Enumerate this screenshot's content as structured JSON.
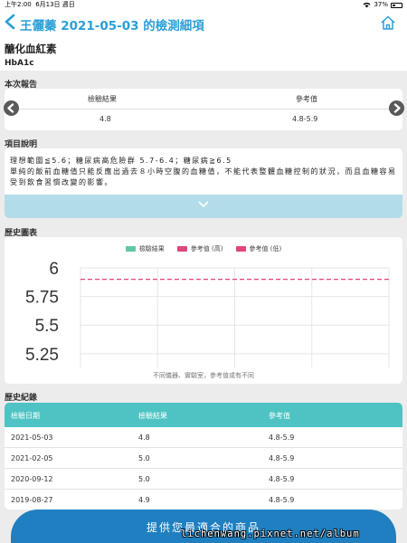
{
  "status_bar": {
    "time": "上午2:00",
    "date": "6月13日 週日",
    "battery": "37%"
  },
  "nav": {
    "title": "王儷蓁 2021-05-03 的檢測細項"
  },
  "item": {
    "name": "醣化血紅素",
    "code": "HbA1c"
  },
  "report": {
    "section_label": "本次報告",
    "col_result": "檢驗結果",
    "col_reference": "參考值",
    "result_value": "4.8",
    "reference_value": "4.8-5.9"
  },
  "description": {
    "section_label": "項目說明",
    "line1": "理想範圍≦5.6；糖尿病高危險群 5.7-6.4；糖尿病≧6.5",
    "line2": "單純的飯前血糖值只能反應出過去８小時空腹的血糖值，不能代表整體血糖控制的狀況，而且血糖容易受到飲食習慣改變的影響。"
  },
  "chart": {
    "section_label": "歷史圖表",
    "note": "不同儀器、實驗室，參考值或有不同"
  },
  "chart_data": {
    "type": "line",
    "y_ticks": [
      "6",
      "5.75",
      "5.5",
      "5.25"
    ],
    "ylim": [
      5.13,
      6.0
    ],
    "grid": true,
    "legend_position": "top-center",
    "series": [
      {
        "name": "檢驗結果",
        "color": "#5ec8a6",
        "values": []
      },
      {
        "name": "參考值 (高)",
        "color": "#e0457b",
        "values": [
          5.9
        ]
      },
      {
        "name": "參考值 (低)",
        "color": "#e0457b",
        "values": []
      }
    ],
    "x_gridlines": 4
  },
  "history": {
    "section_label": "歷史紀錄",
    "col_date": "檢驗日期",
    "col_result": "檢驗結果",
    "col_reference": "參考值",
    "rows": [
      {
        "date": "2021-05-03",
        "result": "4.8",
        "reference": "4.8-5.9"
      },
      {
        "date": "2021-02-05",
        "result": "5.0",
        "reference": "4.8-5.9"
      },
      {
        "date": "2020-09-12",
        "result": "5.0",
        "reference": "4.8-5.9"
      },
      {
        "date": "2019-08-27",
        "result": "4.9",
        "reference": "4.8-5.9"
      }
    ]
  },
  "bottom_button": {
    "label": "提供您最適合的商品"
  },
  "watermark": "lichenwang.pixnet.net/album",
  "colors": {
    "accent": "#2a9fd8",
    "table_header": "#4fc3c3",
    "expand_bar": "#b3dcea",
    "bottom_button": "#1f7fc0"
  }
}
